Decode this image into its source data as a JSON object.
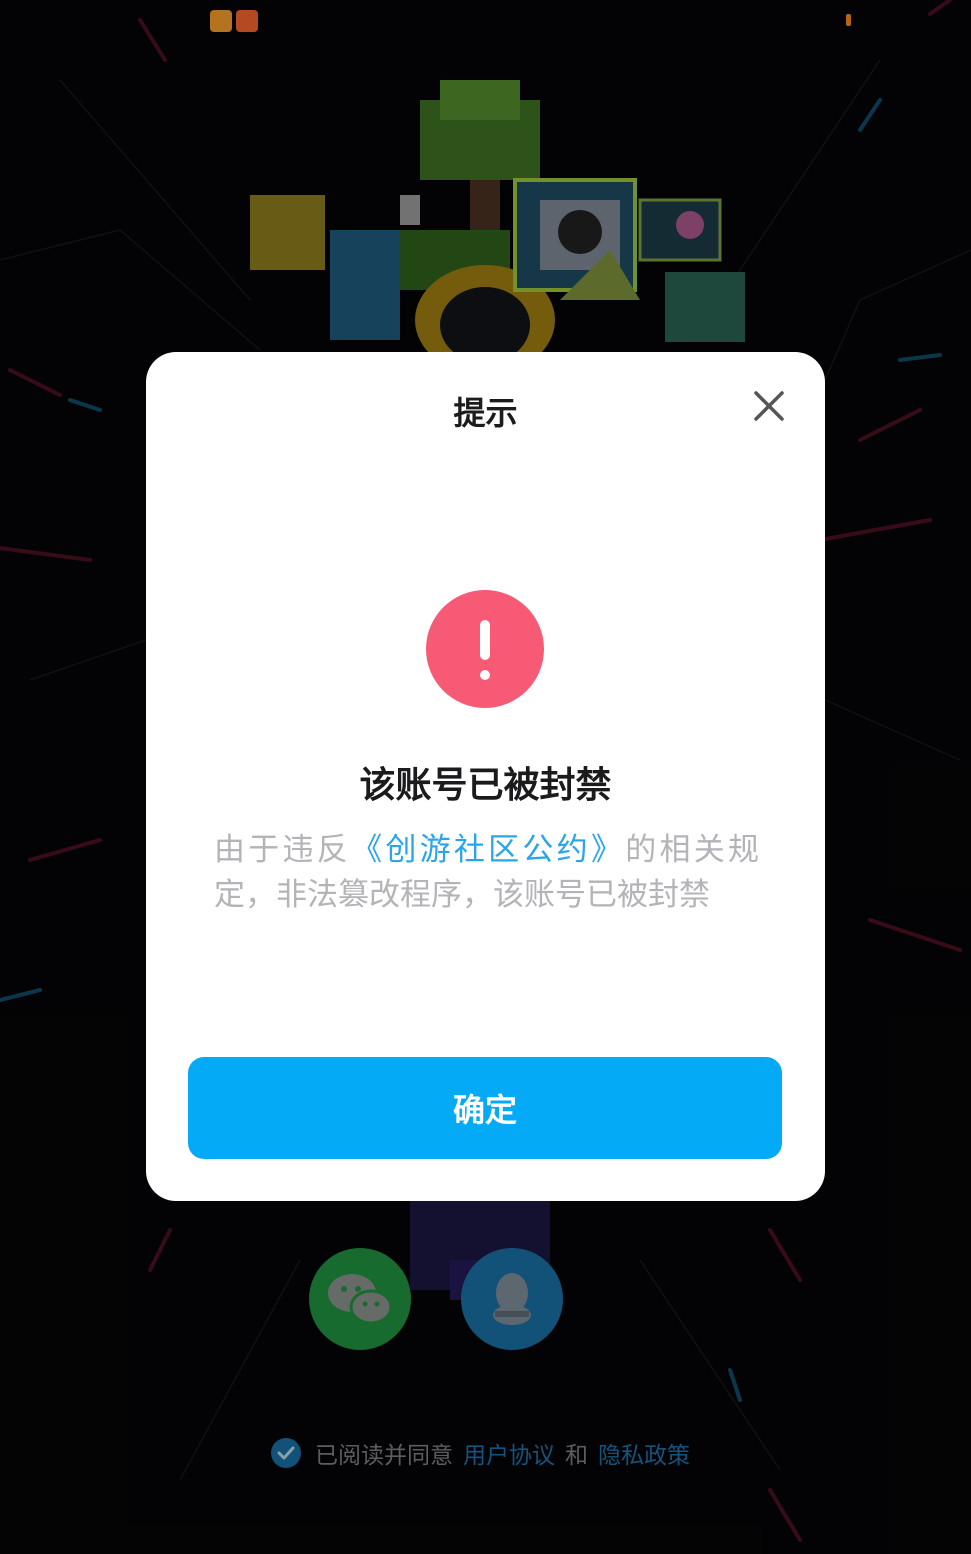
{
  "colors": {
    "background": "#050507",
    "dialog_bg": "#ffffff",
    "alert": "#f65a75",
    "primary": "#05aaf6",
    "link": "#2aa4ea",
    "wechat": "#1f8f3f",
    "qq": "#1a6ea0"
  },
  "status_bar": {
    "icons": [
      "video-app-icon",
      "shopping-app-icon"
    ]
  },
  "dialog": {
    "title": "提示",
    "close_icon": "close-icon",
    "alert_icon": "exclamation-icon",
    "headline": "该账号已被封禁",
    "message_prefix": "由于违反",
    "message_link": "《创游社区公约》",
    "message_suffix": "的相关规定，非法篡改程序，该账号已被封禁",
    "confirm_label": "确定"
  },
  "login": {
    "social_buttons": [
      {
        "name": "wechat-login-button",
        "icon": "wechat-icon"
      },
      {
        "name": "qq-login-button",
        "icon": "qq-icon"
      }
    ],
    "agreement": {
      "prefix": "已阅读并同意",
      "user_agreement": "用户协议",
      "conjunction": "和",
      "privacy_policy": "隐私政策"
    }
  }
}
